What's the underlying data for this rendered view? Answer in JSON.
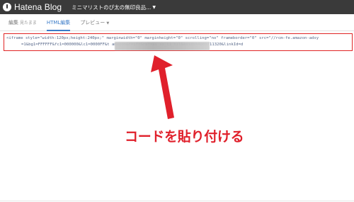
{
  "header": {
    "logo_text": "Hatena Blog",
    "blog_name": "ミニマリストのぴ太の無印良品..."
  },
  "tabs": [
    {
      "label": "編集",
      "sub": "見たまま"
    },
    {
      "label": "HTML編集"
    },
    {
      "label": "プレビュー"
    }
  ],
  "editor": {
    "line1": "<iframe style=\"width:120px;height:240px;\" marginwidth=\"0\" marginheight=\"0\" scrolling=\"no\" frameborder=\"0\" src=\"//rcm-fe.amazon-adsy",
    "line2": "=1&bg1=FFFFFF&fc1=000000&lc1=0000FF&t                                    amazon&f=ifr&ref=as_ss_li_til&asins=4800711320&linkId=d"
  },
  "annotation": {
    "text": "コードを貼り付ける",
    "color": "#e0202b"
  },
  "colors": {
    "topbar": "#3a3a3a",
    "accent": "#3a7bc8",
    "highlight_border": "#e02424"
  }
}
